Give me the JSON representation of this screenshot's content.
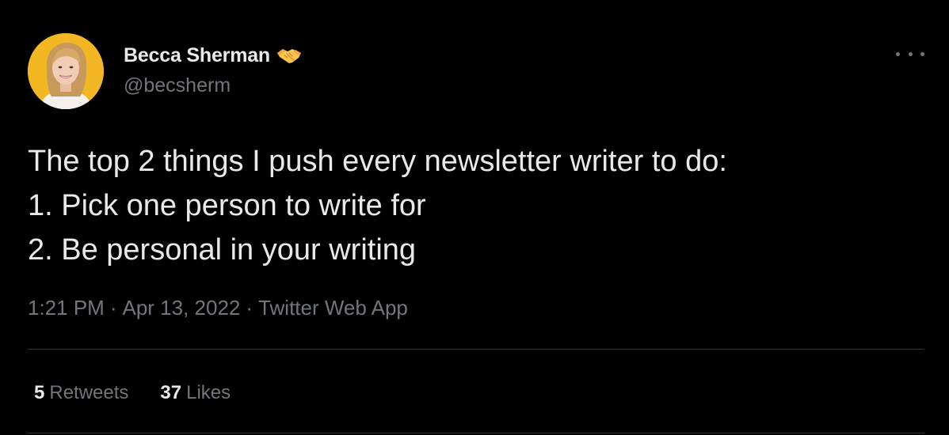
{
  "tweet": {
    "author": {
      "display_name": "Becca Sherman",
      "handle": "@becsherm",
      "name_emoji": "handshake-icon",
      "avatar_bg": "#f2b722"
    },
    "text_lines": [
      "The top 2 things I push every newsletter writer to do:",
      "1. Pick one person to write for",
      "2. Be personal in your writing"
    ],
    "time": "1:21 PM",
    "date": "Apr 13, 2022",
    "separator": "·",
    "source": "Twitter Web App",
    "stats": {
      "retweets_count": "5",
      "retweets_label": "Retweets",
      "likes_count": "37",
      "likes_label": "Likes"
    },
    "more_icon": "more-options-icon"
  },
  "colors": {
    "background": "#000000",
    "primary_text": "#e7e9ea",
    "secondary_text": "#71767b",
    "divider": "#2f3336"
  }
}
